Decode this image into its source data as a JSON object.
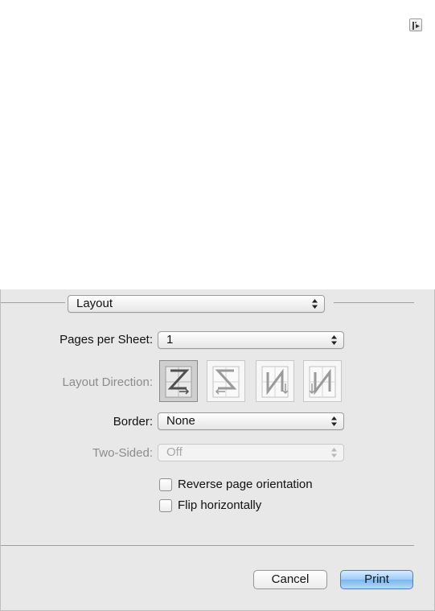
{
  "dialog": {
    "section_popup": "Layout",
    "pages_per_sheet": {
      "label": "Pages per Sheet:",
      "value": "1"
    },
    "layout_direction": {
      "label": "Layout Direction:",
      "options": [
        "z-order",
        "reverse-z-order",
        "n-order",
        "reverse-n-order"
      ],
      "selected": "z-order"
    },
    "border": {
      "label": "Border:",
      "value": "None"
    },
    "two_sided": {
      "label": "Two-Sided:",
      "value": "Off"
    },
    "checkboxes": [
      {
        "label": "Reverse page orientation",
        "checked": false
      },
      {
        "label": "Flip horizontally",
        "checked": false
      }
    ],
    "buttons": {
      "cancel": "Cancel",
      "print": "Print"
    }
  },
  "icons": {
    "corner_icon": "disclosure-icon"
  },
  "colors": {
    "panel": "#e8e8e8",
    "primary_button": "#7db4ef",
    "disabled_text": "#a8a8a8"
  }
}
